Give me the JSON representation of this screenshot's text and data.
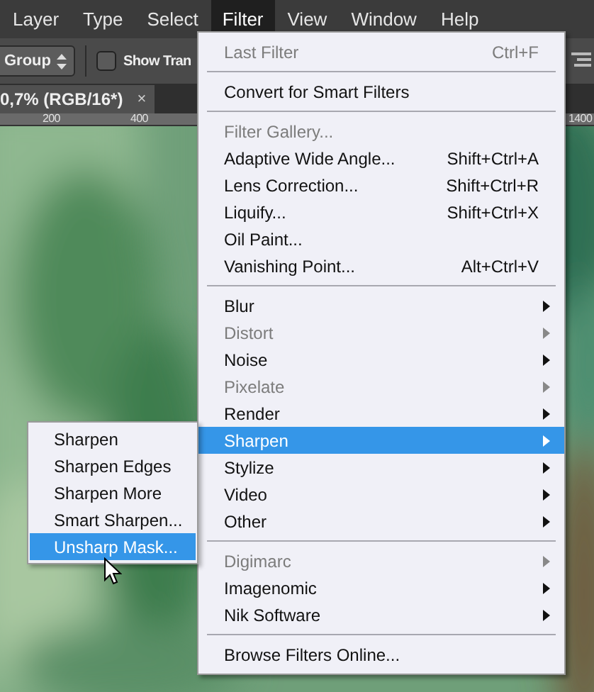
{
  "menubar": [
    {
      "label": "Layer",
      "selected": false
    },
    {
      "label": "Type",
      "selected": false
    },
    {
      "label": "Select",
      "selected": false
    },
    {
      "label": "Filter",
      "selected": true
    },
    {
      "label": "View",
      "selected": false
    },
    {
      "label": "Window",
      "selected": false
    },
    {
      "label": "Help",
      "selected": false
    }
  ],
  "options_bar": {
    "dropdown": "Group",
    "checkbox": {
      "label": "Show Tran",
      "checked": false
    }
  },
  "document_tab": {
    "title": "0,7% (RGB/16*)",
    "close": "×"
  },
  "ruler": [
    "200",
    "400",
    "1400"
  ],
  "canvas": {
    "kind": "picture"
  },
  "filter_menu": [
    [
      {
        "label": "Last Filter",
        "shortcut": "Ctrl+F",
        "disabled": true,
        "submenu": false,
        "selected": false
      }
    ],
    [
      {
        "label": "Convert for Smart Filters",
        "disabled": false,
        "submenu": false,
        "selected": false
      }
    ],
    [
      {
        "label": "Filter Gallery...",
        "disabled": true,
        "submenu": false,
        "selected": false
      },
      {
        "label": "Adaptive Wide Angle...",
        "shortcut": "Shift+Ctrl+A",
        "disabled": false,
        "submenu": false,
        "selected": false
      },
      {
        "label": "Lens Correction...",
        "shortcut": "Shift+Ctrl+R",
        "disabled": false,
        "submenu": false,
        "selected": false
      },
      {
        "label": "Liquify...",
        "shortcut": "Shift+Ctrl+X",
        "disabled": false,
        "submenu": false,
        "selected": false
      },
      {
        "label": "Oil Paint...",
        "disabled": false,
        "submenu": false,
        "selected": false
      },
      {
        "label": "Vanishing Point...",
        "shortcut": "Alt+Ctrl+V",
        "disabled": false,
        "submenu": false,
        "selected": false
      }
    ],
    [
      {
        "label": "Blur",
        "disabled": false,
        "submenu": true,
        "selected": false
      },
      {
        "label": "Distort",
        "disabled": true,
        "submenu": true,
        "selected": false
      },
      {
        "label": "Noise",
        "disabled": false,
        "submenu": true,
        "selected": false
      },
      {
        "label": "Pixelate",
        "disabled": true,
        "submenu": true,
        "selected": false
      },
      {
        "label": "Render",
        "disabled": false,
        "submenu": true,
        "selected": false
      },
      {
        "label": "Sharpen",
        "disabled": false,
        "submenu": true,
        "selected": true
      },
      {
        "label": "Stylize",
        "disabled": false,
        "submenu": true,
        "selected": false
      },
      {
        "label": "Video",
        "disabled": false,
        "submenu": true,
        "selected": false
      },
      {
        "label": "Other",
        "disabled": false,
        "submenu": true,
        "selected": false
      }
    ],
    [
      {
        "label": "Digimarc",
        "disabled": true,
        "submenu": true,
        "selected": false
      },
      {
        "label": "Imagenomic",
        "disabled": false,
        "submenu": true,
        "selected": false
      },
      {
        "label": "Nik Software",
        "disabled": false,
        "submenu": true,
        "selected": false
      }
    ],
    [
      {
        "label": "Browse Filters Online...",
        "disabled": false,
        "submenu": false,
        "selected": false
      }
    ]
  ],
  "sharpen_submenu": [
    {
      "label": "Sharpen",
      "selected": false
    },
    {
      "label": "Sharpen Edges",
      "selected": false
    },
    {
      "label": "Sharpen More",
      "selected": false
    },
    {
      "label": "Smart Sharpen...",
      "selected": false
    },
    {
      "label": "Unsharp Mask...",
      "selected": true
    }
  ]
}
